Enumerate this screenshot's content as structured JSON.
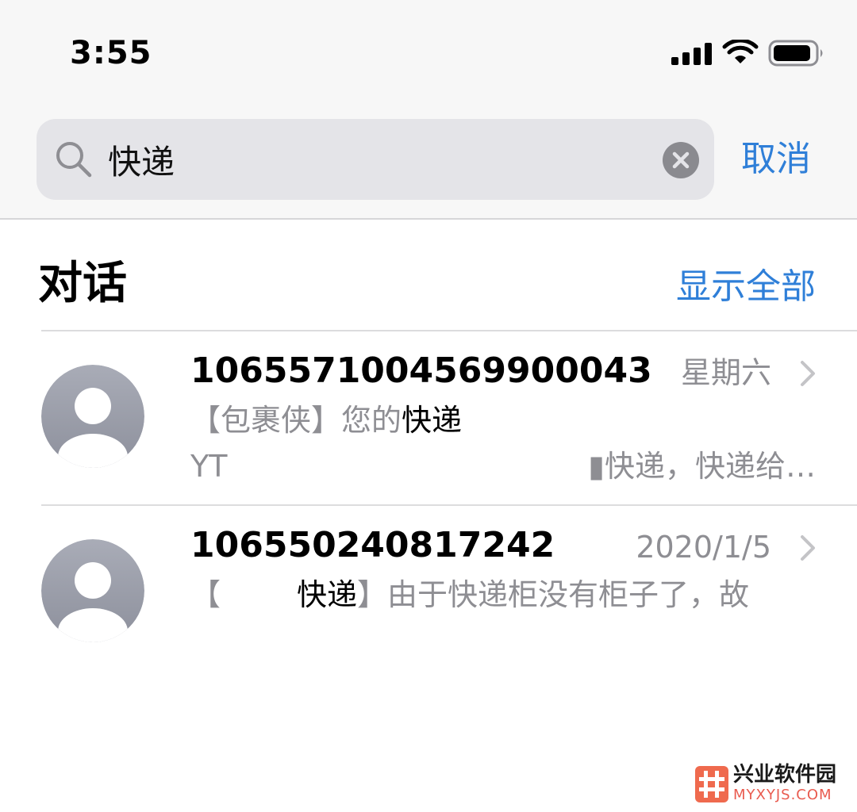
{
  "status_bar": {
    "time": "3:55",
    "icons": [
      "signal-icon",
      "wifi-icon",
      "battery-icon"
    ]
  },
  "search": {
    "value": "快递",
    "placeholder": "",
    "cancel_label": "取消"
  },
  "section": {
    "title": "对话",
    "show_all_label": "显示全部"
  },
  "conversations": [
    {
      "sender": "1065571004569900043",
      "date": "星期六",
      "preview_line1_prefix": "【包裹侠】您的",
      "preview_line1_match": "快递",
      "preview_line2_left": "YT",
      "preview_line2_right": "▮快递，快递给…"
    },
    {
      "sender": "106550240817242",
      "date": "2020/1/5",
      "preview_bracket_open": "【",
      "preview_match": "快递",
      "preview_rest": "】由于快递柜没有柜子了，故"
    }
  ],
  "colors": {
    "accent": "#2f7fd8",
    "secondary_text": "#8e8e93",
    "avatar_gray": "#a3a6b1"
  },
  "watermark": {
    "name": "兴业软件园",
    "url": "MYXYJS.COM"
  }
}
